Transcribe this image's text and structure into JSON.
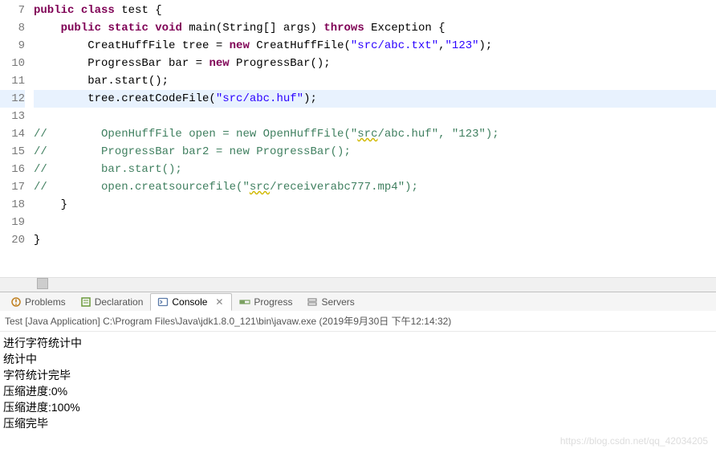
{
  "code": {
    "lines": [
      {
        "n": 7,
        "frags": [
          {
            "t": "public",
            "c": "kw"
          },
          {
            "t": " "
          },
          {
            "t": "class",
            "c": "kw"
          },
          {
            "t": " test {"
          }
        ]
      },
      {
        "n": 8,
        "frags": [
          {
            "t": "    "
          },
          {
            "t": "public",
            "c": "kw"
          },
          {
            "t": " "
          },
          {
            "t": "static",
            "c": "kw"
          },
          {
            "t": " "
          },
          {
            "t": "void",
            "c": "kw"
          },
          {
            "t": " main(String[] args) "
          },
          {
            "t": "throws",
            "c": "kw"
          },
          {
            "t": " Exception {"
          }
        ]
      },
      {
        "n": 9,
        "frags": [
          {
            "t": "        CreatHuffFile tree = "
          },
          {
            "t": "new",
            "c": "kw"
          },
          {
            "t": " CreatHuffFile("
          },
          {
            "t": "\"src/abc.txt\"",
            "c": "str"
          },
          {
            "t": ","
          },
          {
            "t": "\"123\"",
            "c": "str"
          },
          {
            "t": ");"
          }
        ]
      },
      {
        "n": 10,
        "frags": [
          {
            "t": "        ProgressBar bar = "
          },
          {
            "t": "new",
            "c": "kw"
          },
          {
            "t": " ProgressBar();"
          }
        ]
      },
      {
        "n": 11,
        "frags": [
          {
            "t": "        bar.start();"
          }
        ]
      },
      {
        "n": 12,
        "hl": true,
        "frags": [
          {
            "t": "        tree.creatCodeFile("
          },
          {
            "t": "\"src/abc.huf\"",
            "c": "str"
          },
          {
            "t": ");"
          }
        ]
      },
      {
        "n": 13,
        "frags": [
          {
            "t": ""
          }
        ]
      },
      {
        "n": 14,
        "frags": [
          {
            "t": "//        OpenHuffFile open = new OpenHuffFile(\"",
            "c": "com"
          },
          {
            "t": "src",
            "c": "com squiggle"
          },
          {
            "t": "/abc.huf\", \"123\");",
            "c": "com"
          }
        ]
      },
      {
        "n": 15,
        "frags": [
          {
            "t": "//        ProgressBar bar2 = new ProgressBar();",
            "c": "com"
          }
        ]
      },
      {
        "n": 16,
        "frags": [
          {
            "t": "//        bar.start();",
            "c": "com"
          }
        ]
      },
      {
        "n": 17,
        "frags": [
          {
            "t": "//        open.creatsourcefile(\"",
            "c": "com"
          },
          {
            "t": "src",
            "c": "com squiggle"
          },
          {
            "t": "/receiverabc777.mp4\");",
            "c": "com"
          }
        ]
      },
      {
        "n": 18,
        "frags": [
          {
            "t": "    }"
          }
        ]
      },
      {
        "n": 19,
        "frags": [
          {
            "t": ""
          }
        ]
      },
      {
        "n": 20,
        "frags": [
          {
            "t": "}"
          }
        ]
      }
    ]
  },
  "views": {
    "problems": "Problems",
    "declaration": "Declaration",
    "console": "Console",
    "progress": "Progress",
    "servers": "Servers"
  },
  "run_info": "Test [Java Application] C:\\Program Files\\Java\\jdk1.8.0_121\\bin\\javaw.exe (2019年9月30日 下午12:14:32)",
  "console_lines": [
    "进行字符统计中",
    "统计中",
    "字符统计完毕",
    "压缩进度:0%",
    "压缩进度:100%",
    "压缩完毕"
  ],
  "watermark": "https://blog.csdn.net/qq_42034205"
}
